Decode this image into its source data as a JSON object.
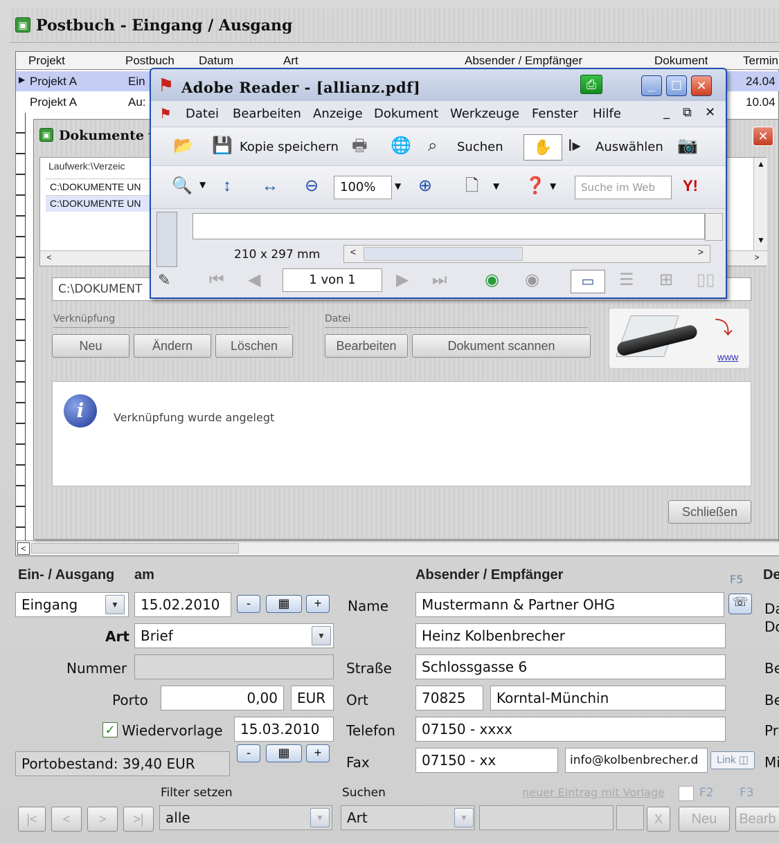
{
  "main_window": {
    "title": "Postbuch - Eingang / Ausgang",
    "columns": [
      "Projekt",
      "Postbuch",
      "Datum",
      "Art",
      "Absender / Empfänger",
      "Dokument",
      "Termin"
    ],
    "rows": [
      {
        "projekt": "Projekt A",
        "postbuch": "Ein",
        "termin": "24.04"
      },
      {
        "projekt": "Projekt A",
        "postbuch": "Au:",
        "termin": "10.04"
      }
    ]
  },
  "documents_dialog": {
    "title": "Dokumente ve",
    "grid_header": "Laufwerk:\\Verzeic",
    "grid_rows": [
      "C:\\DOKUMENTE UN",
      "C:\\DOKUMENTE UN"
    ],
    "path_value": "C:\\DOKUMENT",
    "verknuepfung_label": "Verknüpfung",
    "datei_label": "Datei",
    "buttons": {
      "neu": "Neu",
      "aendern": "Ändern",
      "loeschen": "Löschen",
      "bearbeiten": "Bearbeiten",
      "scannen": "Dokument scannen",
      "schliessen": "Schließen"
    },
    "www_link": "www",
    "info_message": "Verknüpfung wurde angelegt"
  },
  "adobe_reader": {
    "title": "Adobe Reader - [allianz.pdf]",
    "menu": [
      "Datei",
      "Bearbeiten",
      "Anzeige",
      "Dokument",
      "Werkzeuge",
      "Fenster",
      "Hilfe"
    ],
    "toolbar": {
      "save_copy": "Kopie speichern",
      "search": "Suchen",
      "select": "Auswählen",
      "zoom": "100%",
      "web_search_placeholder": "Suche im Web"
    },
    "page_size": "210 x 297 mm",
    "page_indicator": "1 von 1"
  },
  "form": {
    "section_ein_ausgang": "Ein- / Ausgang",
    "section_am": "am",
    "section_absender": "Absender / Empfänger",
    "section_de": "De",
    "f5": "F5",
    "direction_value": "Eingang",
    "date_value": "15.02.2010",
    "art_label": "Art",
    "art_value": "Brief",
    "nummer_label": "Nummer",
    "porto_label": "Porto",
    "porto_value": "0,00",
    "currency": "EUR",
    "wiedervorlage_label": "Wiedervorlage",
    "wiedervorlage_date": "15.03.2010",
    "portobestand": "Portobestand:  39,40 EUR",
    "name_label": "Name",
    "name_value": "Mustermann & Partner OHG",
    "contact_value": "Heinz Kolbenbrecher",
    "strasse_label": "Straße",
    "strasse_value": "Schlossgasse 6",
    "ort_label": "Ort",
    "plz_value": "70825",
    "ort_value": "Korntal-Münchin",
    "telefon_label": "Telefon",
    "telefon_value": "07150 - xxxx",
    "fax_label": "Fax",
    "fax_value": "07150 - xx",
    "email_value": "info@kolbenbrecher.d",
    "link_label": "Link",
    "right_labels": [
      "Da",
      "Do",
      "Be",
      "Be",
      "Pr",
      "Mi"
    ],
    "minus": "-",
    "plus": "+"
  },
  "bottom_bar": {
    "filter_label": "Filter setzen",
    "filter_value": "alle",
    "suchen_label": "Suchen",
    "suchen_value": "Art",
    "neuer_eintrag": "neuer Eintrag mit Vorlage",
    "f2": "F2",
    "f3": "F3",
    "x": "X",
    "neu": "Neu",
    "bearb": "Bearb",
    "nav": [
      "|<",
      "<",
      ">",
      ">|"
    ]
  }
}
